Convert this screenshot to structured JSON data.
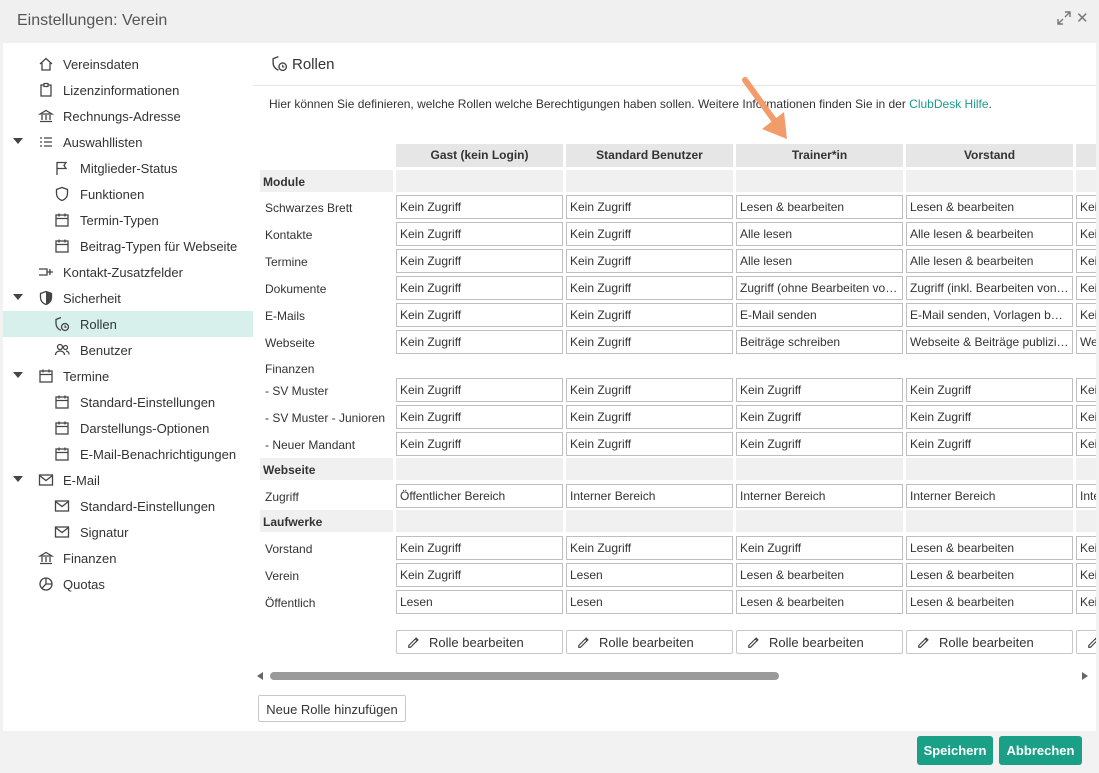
{
  "window": {
    "title": "Einstellungen: Verein"
  },
  "sidebar": {
    "items": [
      {
        "label": "Vereinsdaten",
        "icon": "home-icon",
        "level": 1,
        "caret": false
      },
      {
        "label": "Lizenzinformationen",
        "icon": "clipboard-icon",
        "level": 1,
        "caret": false
      },
      {
        "label": "Rechnungs-Adresse",
        "icon": "bank-icon",
        "level": 1,
        "caret": false
      },
      {
        "label": "Auswahllisten",
        "icon": "list-icon",
        "level": 1,
        "caret": true
      },
      {
        "label": "Mitglieder-Status",
        "icon": "flag-icon",
        "level": 2,
        "caret": false
      },
      {
        "label": "Funktionen",
        "icon": "shield-outline-icon",
        "level": 2,
        "caret": false
      },
      {
        "label": "Termin-Typen",
        "icon": "calendar-icon",
        "level": 2,
        "caret": false
      },
      {
        "label": "Beitrag-Typen für Webseite",
        "icon": "calendar-icon",
        "level": 2,
        "caret": false
      },
      {
        "label": "Kontakt-Zusatzfelder",
        "icon": "field-add-icon",
        "level": 1,
        "caret": false
      },
      {
        "label": "Sicherheit",
        "icon": "shield-icon",
        "level": 1,
        "caret": true
      },
      {
        "label": "Rollen",
        "icon": "role-shield-icon",
        "level": 2,
        "caret": false,
        "selected": true
      },
      {
        "label": "Benutzer",
        "icon": "users-icon",
        "level": 2,
        "caret": false
      },
      {
        "label": "Termine",
        "icon": "calendar-icon",
        "level": 1,
        "caret": true
      },
      {
        "label": "Standard-Einstellungen",
        "icon": "calendar-icon",
        "level": 2,
        "caret": false
      },
      {
        "label": "Darstellungs-Optionen",
        "icon": "calendar-icon",
        "level": 2,
        "caret": false
      },
      {
        "label": "E-Mail-Benachrichtigungen",
        "icon": "calendar-icon",
        "level": 2,
        "caret": false
      },
      {
        "label": "E-Mail",
        "icon": "envelope-icon",
        "level": 1,
        "caret": true
      },
      {
        "label": "Standard-Einstellungen",
        "icon": "envelope-icon",
        "level": 2,
        "caret": false
      },
      {
        "label": "Signatur",
        "icon": "envelope-icon",
        "level": 2,
        "caret": false
      },
      {
        "label": "Finanzen",
        "icon": "bank-icon",
        "level": 1,
        "caret": false
      },
      {
        "label": "Quotas",
        "icon": "pie-icon",
        "level": 1,
        "caret": false
      }
    ]
  },
  "panel": {
    "title": "Rollen",
    "intro_text": "Hier können Sie definieren, welche Rollen welche Berechtigungen haben sollen. Weitere Informationen finden Sie in der ",
    "intro_link": "ClubDesk Hilfe",
    "intro_end": "."
  },
  "table": {
    "columns": [
      "Gast (kein Login)",
      "Standard Benutzer",
      "Trainer*in",
      "Vorstand",
      ""
    ],
    "rows": [
      {
        "type": "section",
        "label": "Module"
      },
      {
        "type": "row",
        "label": "Schwarzes Brett",
        "values": [
          "Kein Zugriff",
          "Kein Zugriff",
          "Lesen & bearbeiten",
          "Lesen & bearbeiten",
          "Kein Zugriff"
        ]
      },
      {
        "type": "row",
        "label": "Kontakte",
        "values": [
          "Kein Zugriff",
          "Kein Zugriff",
          "Alle lesen",
          "Alle lesen & bearbeiten",
          "Kein Zugriff"
        ]
      },
      {
        "type": "row",
        "label": "Termine",
        "values": [
          "Kein Zugriff",
          "Kein Zugriff",
          "Alle lesen",
          "Alle lesen & bearbeiten",
          "Kein Zugriff"
        ]
      },
      {
        "type": "row",
        "label": "Dokumente",
        "values": [
          "Kein Zugriff",
          "Kein Zugriff",
          "Zugriff (ohne Bearbeiten von Ordnern)",
          "Zugriff (inkl. Bearbeiten von Ordnern)",
          "Kein Zugriff"
        ]
      },
      {
        "type": "row",
        "label": "E-Mails",
        "values": [
          "Kein Zugriff",
          "Kein Zugriff",
          "E-Mail senden",
          "E-Mail senden, Vorlagen bearbeiten",
          "Kein Zugriff"
        ]
      },
      {
        "type": "row",
        "label": "Webseite",
        "values": [
          "Kein Zugriff",
          "Kein Zugriff",
          "Beiträge schreiben",
          "Webseite & Beiträge publizieren",
          "Webseite"
        ]
      },
      {
        "type": "plain",
        "label": "Finanzen"
      },
      {
        "type": "row",
        "label": "- SV Muster",
        "values": [
          "Kein Zugriff",
          "Kein Zugriff",
          "Kein Zugriff",
          "Kein Zugriff",
          "Kein Zugriff"
        ]
      },
      {
        "type": "row",
        "label": "- SV Muster - Junioren",
        "values": [
          "Kein Zugriff",
          "Kein Zugriff",
          "Kein Zugriff",
          "Kein Zugriff",
          "Kein Zugriff"
        ]
      },
      {
        "type": "row",
        "label": "- Neuer Mandant",
        "values": [
          "Kein Zugriff",
          "Kein Zugriff",
          "Kein Zugriff",
          "Kein Zugriff",
          "Kein Zugriff"
        ]
      },
      {
        "type": "section",
        "label": "Webseite"
      },
      {
        "type": "row",
        "label": "Zugriff",
        "values": [
          "Öffentlicher Bereich",
          "Interner Bereich",
          "Interner Bereich",
          "Interner Bereich",
          "Interner Bereich"
        ]
      },
      {
        "type": "section",
        "label": "Laufwerke"
      },
      {
        "type": "row",
        "label": "Vorstand",
        "values": [
          "Kein Zugriff",
          "Kein Zugriff",
          "Kein Zugriff",
          "Lesen & bearbeiten",
          "Kein Zugriff"
        ]
      },
      {
        "type": "row",
        "label": "Verein",
        "values": [
          "Kein Zugriff",
          "Lesen",
          "Lesen & bearbeiten",
          "Lesen & bearbeiten",
          "Kein Zugriff"
        ]
      },
      {
        "type": "row",
        "label": "Öffentlich",
        "values": [
          "Lesen",
          "Lesen",
          "Lesen & bearbeiten",
          "Lesen & bearbeiten",
          "Kein Zugriff"
        ]
      }
    ],
    "edit_button_label": "Rolle bearbeiten"
  },
  "add_role_label": "Neue Rolle hinzufügen",
  "footer": {
    "save_label": "Speichern",
    "cancel_label": "Abbrechen"
  },
  "colors": {
    "accent": "#1aa087",
    "link": "#1a9b8f",
    "selected_bg": "#d8f0ec",
    "arrow": "#f29b6b"
  }
}
